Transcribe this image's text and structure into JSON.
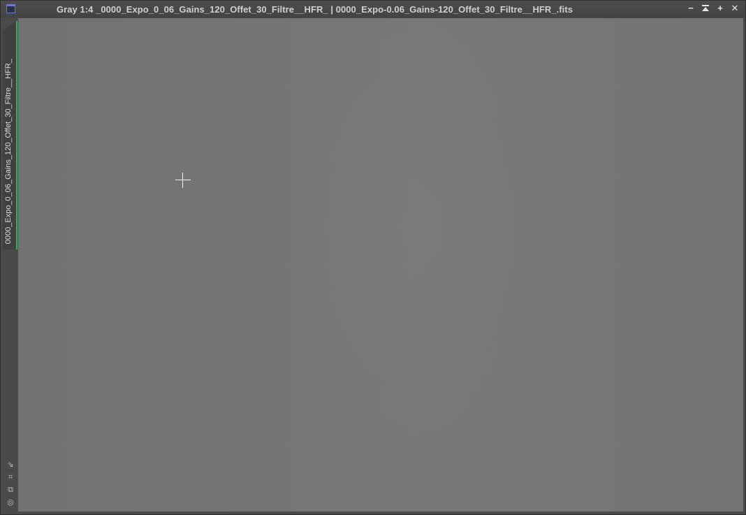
{
  "window": {
    "title": "Gray 1:4 _0000_Expo_0_06_Gains_120_Offet_30_Filtre__HFR_ | 0000_Expo-0.06_Gains-120_Offet_30_Filtre__HFR_.fits",
    "controls": {
      "minimize": "−",
      "shade": "⏶",
      "maximize": "+",
      "close": "✕"
    }
  },
  "sidebar": {
    "tab_label": "0000_Expo_0_06_Gains_120_Offet_30_Filtre__HFR_",
    "tab_accent_color": "#2fb35c",
    "tools": [
      {
        "icon": "fit-arrow-icon",
        "glyph": "⇘"
      },
      {
        "icon": "zoom-fit-icon",
        "glyph": "⌗"
      },
      {
        "icon": "clone-view-icon",
        "glyph": "⧉"
      },
      {
        "icon": "target-icon",
        "glyph": "◎"
      }
    ]
  },
  "canvas": {
    "background_color": "#757575",
    "cursor": "crosshair-icon"
  }
}
